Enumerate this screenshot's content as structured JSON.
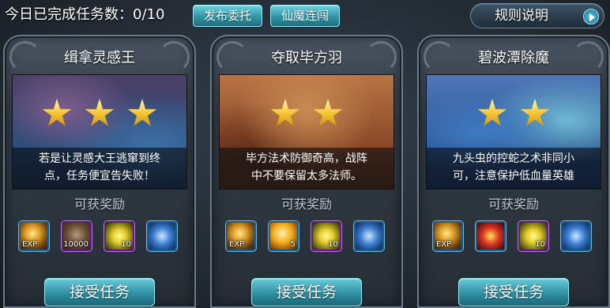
{
  "top_bar": {
    "progress_label": "今日已完成任务数：",
    "progress_value": "0/10",
    "buttons": [
      "发布委托",
      "仙魔连闯"
    ],
    "rules_label": "规则说明"
  },
  "reward_label": "可获奖励",
  "accept_label": "接受任务",
  "quests": [
    {
      "title": "缉拿灵感王",
      "stars": 3,
      "description_line1": "若是让灵感大王逃窜到终",
      "description_line2": "点，任务便宣告失败！",
      "rewards": [
        {
          "icon": "exp-icon",
          "text": "EXP"
        },
        {
          "icon": "treasure-box-icon",
          "text": "10000"
        },
        {
          "icon": "gold-ore-icon",
          "text": "10"
        },
        {
          "icon": "blue-shield-icon",
          "text": ""
        }
      ]
    },
    {
      "title": "夺取毕方羽",
      "stars": 2,
      "description_line1": "毕方法术防御奇高，战阵",
      "description_line2": "中不要保留太多法师。",
      "rewards": [
        {
          "icon": "exp-icon",
          "text": "EXP"
        },
        {
          "icon": "gold-coin-icon",
          "text": "5"
        },
        {
          "icon": "gold-ore-icon",
          "text": "10"
        },
        {
          "icon": "blue-shield-icon",
          "text": ""
        }
      ]
    },
    {
      "title": "碧波潭除魔",
      "stars": 2,
      "description_line1": "九头虫的控蛇之术非同小",
      "description_line2": "可，注意保护低血量英雄",
      "rewards": [
        {
          "icon": "exp-icon",
          "text": "EXP"
        },
        {
          "icon": "question-mark-icon",
          "text": ""
        },
        {
          "icon": "gold-ore-icon",
          "text": "10"
        },
        {
          "icon": "blue-shield-icon",
          "text": ""
        }
      ]
    }
  ]
}
